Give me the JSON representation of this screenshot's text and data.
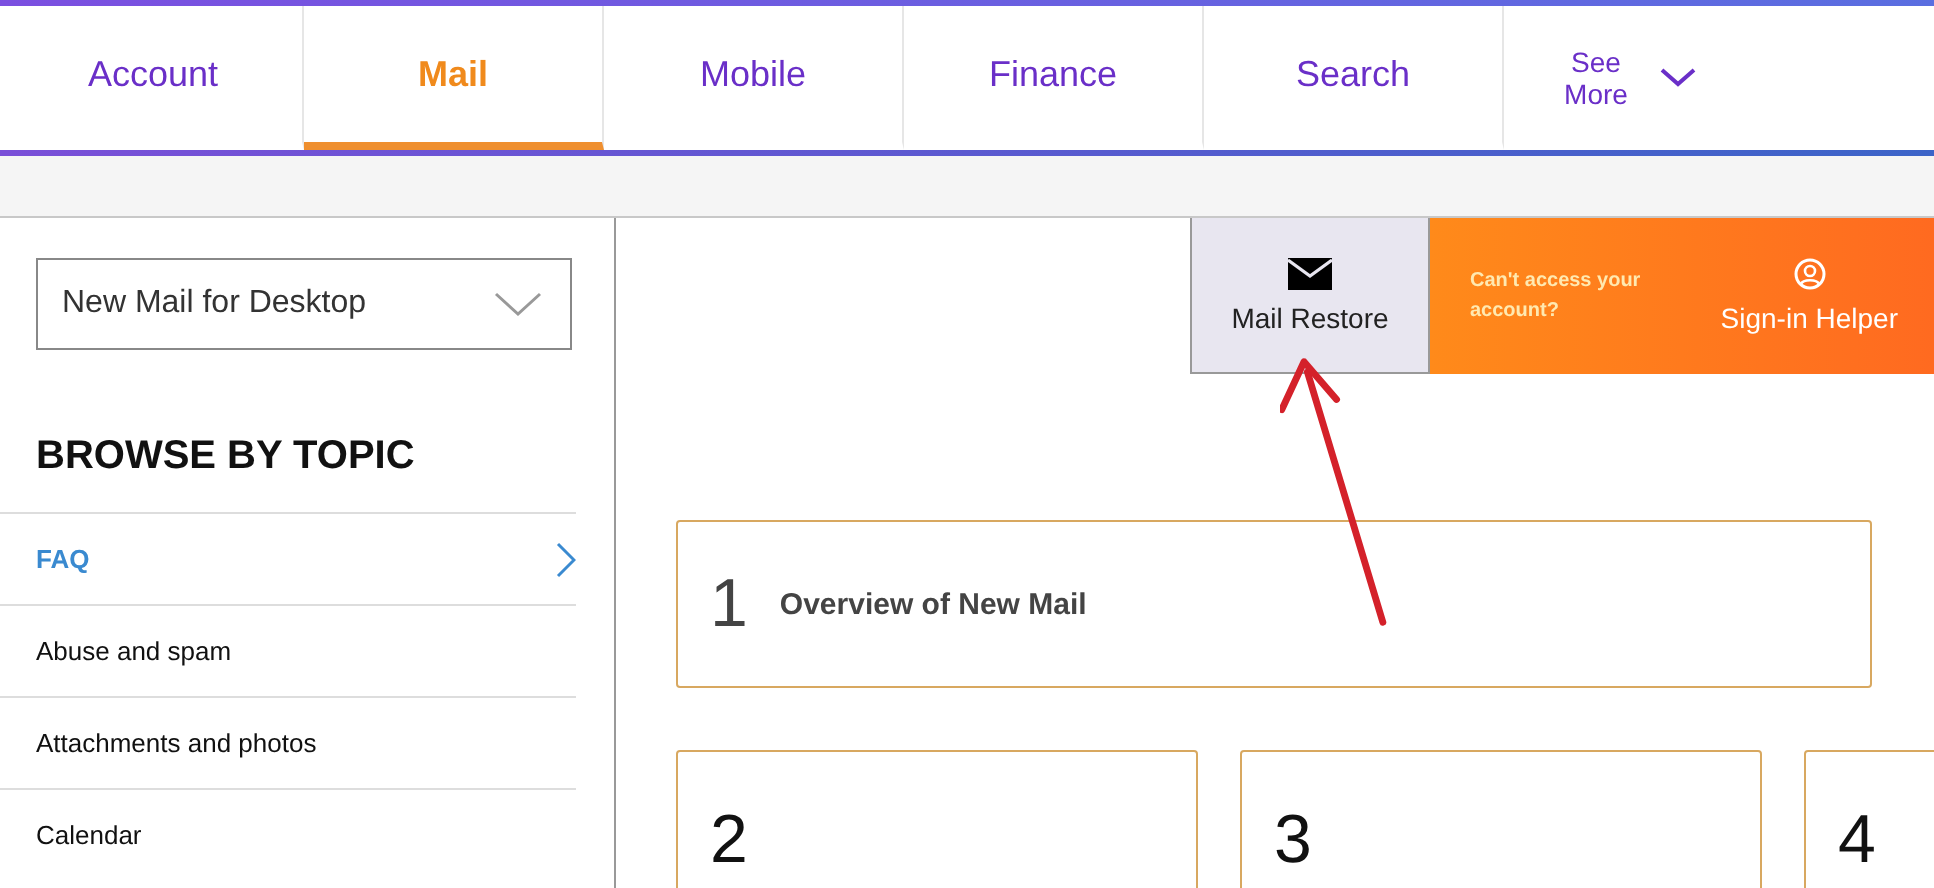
{
  "nav": {
    "tabs": [
      {
        "label": "Account",
        "selected": false
      },
      {
        "label": "Mail",
        "selected": true
      },
      {
        "label": "Mobile",
        "selected": false
      },
      {
        "label": "Finance",
        "selected": false
      },
      {
        "label": "Search",
        "selected": false
      }
    ],
    "more": "See More"
  },
  "sidebar": {
    "dropdown": "New Mail for Desktop",
    "heading": "BROWSE BY TOPIC",
    "items": [
      {
        "label": "FAQ",
        "selected": true
      },
      {
        "label": "Abuse and spam",
        "selected": false
      },
      {
        "label": "Attachments and photos",
        "selected": false
      },
      {
        "label": "Calendar",
        "selected": false
      }
    ]
  },
  "banner": {
    "restore": "Mail Restore",
    "question": "Can't access your account?",
    "helper": "Sign-in Helper"
  },
  "cards": [
    {
      "number": "1",
      "title": "Overview of New Mail"
    },
    {
      "number": "2"
    },
    {
      "number": "3"
    },
    {
      "number": "4"
    }
  ]
}
